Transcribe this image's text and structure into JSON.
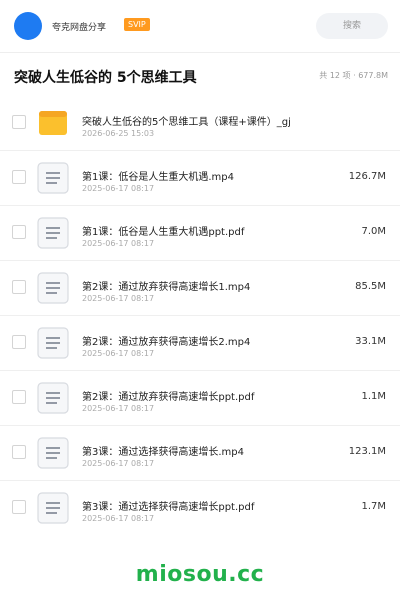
{
  "topbar": {
    "user_name": "夸克网盘分享",
    "badge": "SVIP",
    "search_placeholder": "搜索"
  },
  "header": {
    "title": "突破人生低谷的 5个思维工具",
    "summary": "共 12 项 · 677.8M"
  },
  "files": [
    {
      "icon": "folder-icon",
      "name": "突破人生低谷的5个思维工具（课程+课件）_gj",
      "date": "2026-06-25 15:03",
      "size": ""
    },
    {
      "icon": "file-icon",
      "name": "第1课：低谷是人生重大机遇.mp4",
      "date": "2025-06-17 08:17",
      "size": "126.7M"
    },
    {
      "icon": "file-icon",
      "name": "第1课：低谷是人生重大机遇ppt.pdf",
      "date": "2025-06-17 08:17",
      "size": "7.0M"
    },
    {
      "icon": "file-icon",
      "name": "第2课：通过放弃获得高速增长1.mp4",
      "date": "2025-06-17 08:17",
      "size": "85.5M"
    },
    {
      "icon": "file-icon",
      "name": "第2课：通过放弃获得高速增长2.mp4",
      "date": "2025-06-17 08:17",
      "size": "33.1M"
    },
    {
      "icon": "file-icon",
      "name": "第2课：通过放弃获得高速增长ppt.pdf",
      "date": "2025-06-17 08:17",
      "size": "1.1M"
    },
    {
      "icon": "file-icon",
      "name": "第3课：通过选择获得高速增长.mp4",
      "date": "2025-06-17 08:17",
      "size": "123.1M"
    },
    {
      "icon": "file-icon",
      "name": "第3课：通过选择获得高速增长ppt.pdf",
      "date": "2025-06-17 08:17",
      "size": "1.7M"
    }
  ],
  "watermark": "miosou.cc",
  "colors": {
    "avatar": "#1e7bf2",
    "badge": "#ff9a1f",
    "folder": "#fbc02d",
    "watermark": "#22b14c"
  }
}
